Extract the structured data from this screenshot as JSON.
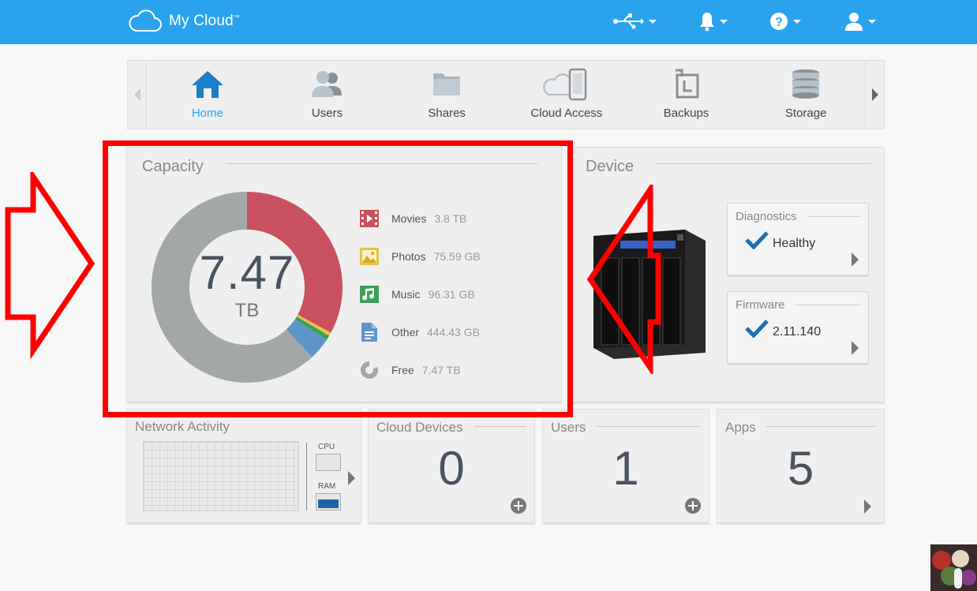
{
  "app": {
    "title": "My Cloud",
    "trademark": "™"
  },
  "header": {
    "icons": [
      "usb-icon",
      "bell-icon",
      "help-icon",
      "user-icon"
    ]
  },
  "nav": {
    "items": [
      {
        "label": "Home",
        "icon": "home-icon",
        "active": true
      },
      {
        "label": "Users",
        "icon": "users-icon",
        "active": false
      },
      {
        "label": "Shares",
        "icon": "shares-icon",
        "active": false
      },
      {
        "label": "Cloud Access",
        "icon": "cloud-access-icon",
        "active": false
      },
      {
        "label": "Backups",
        "icon": "backups-icon",
        "active": false
      },
      {
        "label": "Storage",
        "icon": "storage-icon",
        "active": false
      }
    ]
  },
  "capacity": {
    "title": "Capacity",
    "total": "7.47",
    "unit": "TB",
    "legend": [
      {
        "name": "Movies",
        "value": "3.8 TB",
        "color": "#c9515f",
        "icon": "movies-icon"
      },
      {
        "name": "Photos",
        "value": "75.59 GB",
        "color": "#e7c34a",
        "icon": "photos-icon"
      },
      {
        "name": "Music",
        "value": "96.31 GB",
        "color": "#3aa05a",
        "icon": "music-icon"
      },
      {
        "name": "Other",
        "value": "444.43 GB",
        "color": "#5d96c8",
        "icon": "other-icon"
      },
      {
        "name": "Free",
        "value": "7.47 TB",
        "color": "#a2a8a7",
        "icon": "free-icon"
      }
    ]
  },
  "chart_data": {
    "type": "pie",
    "categories": [
      "Movies",
      "Photos",
      "Music",
      "Other",
      "Free"
    ],
    "values": [
      0.329,
      0.006,
      0.008,
      0.038,
      0.619
    ],
    "colors": [
      "#c9515f",
      "#e7c34a",
      "#3aa05a",
      "#5d96c8",
      "#a2a8a7"
    ]
  },
  "device": {
    "title": "Device",
    "diagnostics": {
      "title": "Diagnostics",
      "status": "Healthy"
    },
    "firmware": {
      "title": "Firmware",
      "version": "2.11.140"
    }
  },
  "network": {
    "title": "Network Activity",
    "cpu_label": "CPU",
    "ram_label": "RAM",
    "cpu_level": 0.0,
    "ram_level": 0.6
  },
  "cloud_devices": {
    "title": "Cloud Devices",
    "count": "0"
  },
  "users_card": {
    "title": "Users",
    "count": "1"
  },
  "apps": {
    "title": "Apps",
    "count": "5"
  },
  "colors": {
    "accent": "#2aa3ef",
    "highlight": "#ff0000",
    "text_dark": "#4a5360"
  }
}
